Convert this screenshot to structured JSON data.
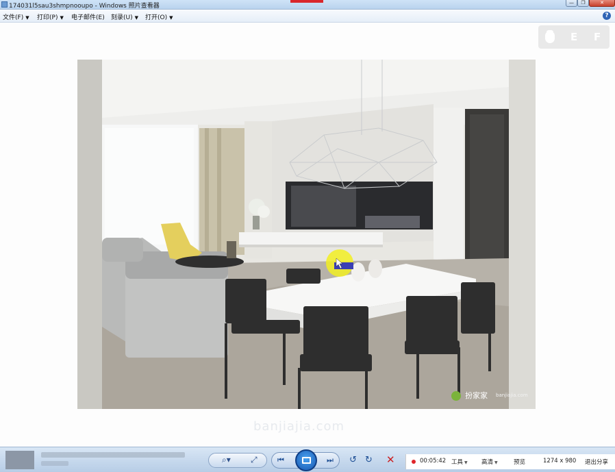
{
  "window": {
    "title": "174031l5sau3shmpnooupo - Windows 照片查看器",
    "min_label": "—",
    "max_label": "❐",
    "close_label": "✕"
  },
  "menu": {
    "items": [
      {
        "label": "文件(F)"
      },
      {
        "label": "打印(P)"
      },
      {
        "label": "电子邮件(E)"
      },
      {
        "label": "刻录(U)"
      },
      {
        "label": "打开(O)"
      }
    ],
    "help_label": "?"
  },
  "overlay": {
    "key_e": "E",
    "key_f": "F"
  },
  "photo": {
    "logo_text": "扮家家",
    "logo_url": "banjiajia.com"
  },
  "watermark": "banjiajia.com",
  "recorder": {
    "time": "00:05:42",
    "tools_label": "工具",
    "quality_label": "高清",
    "preview_label": "预览",
    "resolution": "1274 x 980",
    "exit_label": "退出分享"
  },
  "icons": {
    "zoom": "magnifier-icon",
    "fit": "fit-window-icon",
    "prev": "previous-icon",
    "slideshow": "slideshow-icon",
    "next": "next-icon",
    "rotate_left": "rotate-left-icon",
    "rotate_right": "rotate-right-icon",
    "delete": "delete-icon"
  },
  "colors": {
    "delete": "#cc1f1f",
    "record": "#e0252b",
    "accent": "#1656b0"
  }
}
